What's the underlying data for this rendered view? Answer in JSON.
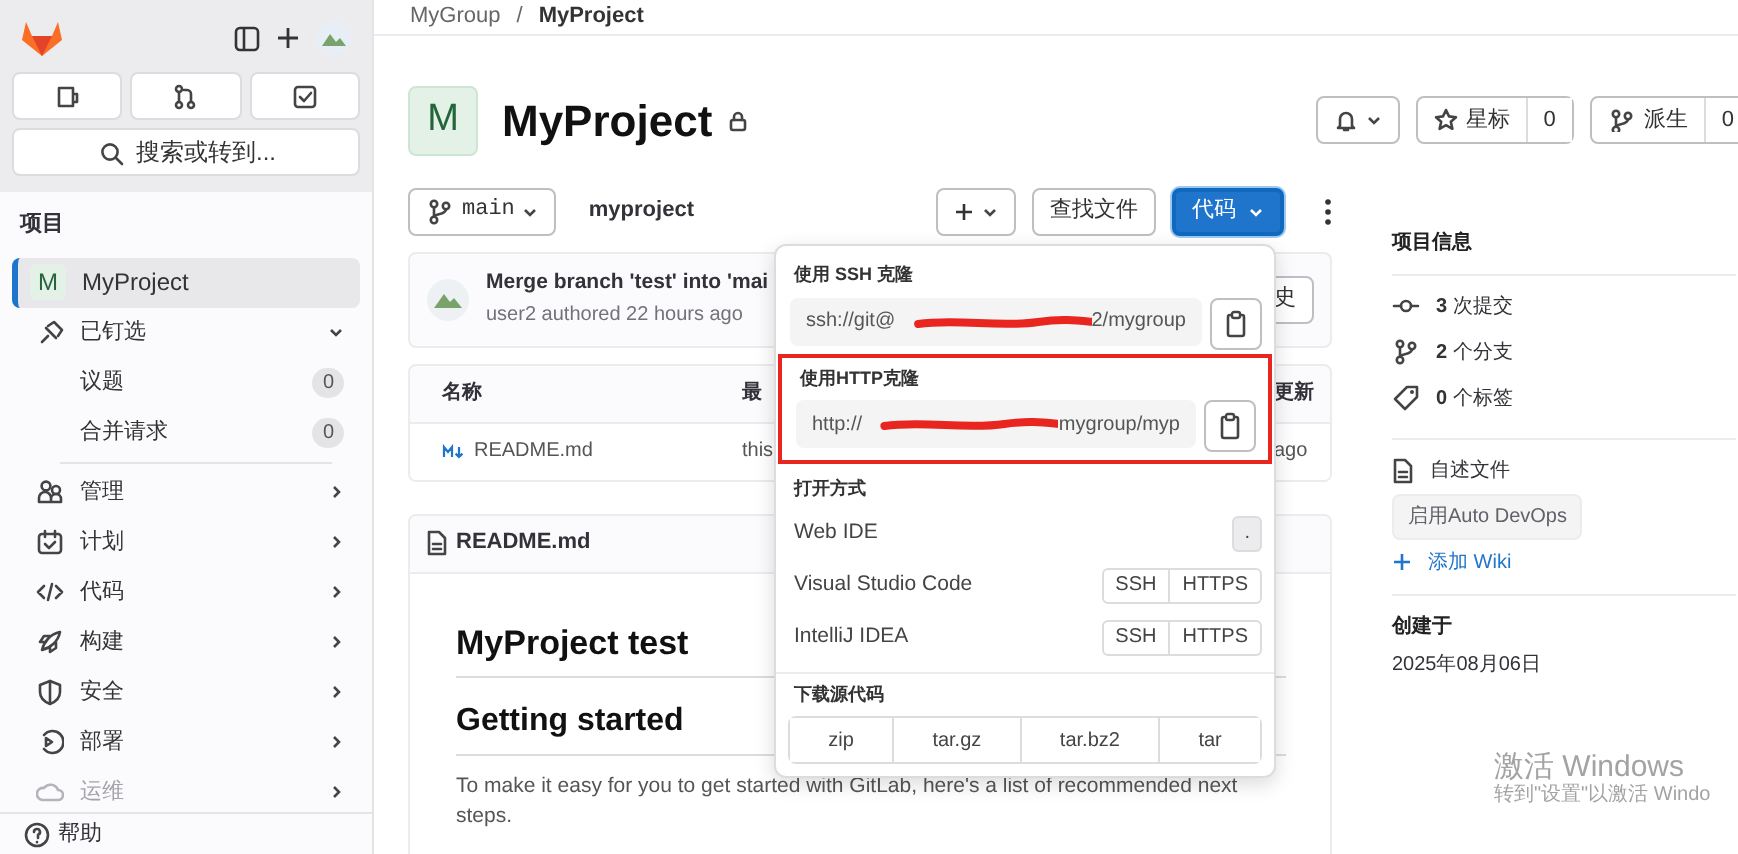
{
  "sidebar": {
    "search": {
      "placeholder": "搜索或转到..."
    },
    "section_title": "项目",
    "items": [
      {
        "kind": "project",
        "avatar": "M",
        "label": "MyProject",
        "selected": true
      },
      {
        "kind": "group",
        "label": "已钉选",
        "expanded": true,
        "selected": false
      },
      {
        "kind": "sub",
        "label": "议题",
        "count": "0",
        "selected": false
      },
      {
        "kind": "sub",
        "label": "合并请求",
        "count": "0",
        "selected": false
      },
      {
        "kind": "menu",
        "label": "管理",
        "selected": false
      },
      {
        "kind": "menu",
        "label": "计划",
        "selected": false
      },
      {
        "kind": "menu",
        "label": "代码",
        "selected": false
      },
      {
        "kind": "menu",
        "label": "构建",
        "selected": false
      },
      {
        "kind": "menu",
        "label": "安全",
        "selected": false
      },
      {
        "kind": "menu",
        "label": "部署",
        "selected": false
      },
      {
        "kind": "menu",
        "label": "运维",
        "selected": false,
        "faded": true
      }
    ],
    "help": "帮助"
  },
  "breadcrumb": [
    {
      "label": "MyGroup",
      "current": false
    },
    {
      "separator": "/",
      "label": "MyProject",
      "current": true
    }
  ],
  "project": {
    "avatar": "M",
    "name": "MyProject"
  },
  "star": {
    "label": "星标",
    "count": "0"
  },
  "fork": {
    "label": "派生",
    "count": "0"
  },
  "branch": "main",
  "path": "myproject",
  "find_file": "查找文件",
  "code_button": "代码",
  "commit": {
    "title": "Merge branch 'test' into 'mai",
    "meta": "user2 authored 22 hours ago",
    "history": "史"
  },
  "files": {
    "columns": [
      "名称",
      "最",
      "更新"
    ],
    "rows": [
      {
        "cells": [
          "README.md",
          "this",
          "ago"
        ]
      }
    ]
  },
  "readme": {
    "title": "README.md",
    "h1": "MyProject test",
    "h2": "Getting started",
    "paragraph": "To make it easy for you to get started with GitLab, here's a list of recommended next steps."
  },
  "clone_menu": {
    "sections": [
      {
        "title": "使用 SSH 克隆",
        "prefix": "ssh://git@",
        "suffix": "2/mygroup",
        "highlighted": false
      },
      {
        "title": "使用HTTP克隆",
        "prefix": "http://",
        "suffix": "mygroup/myp",
        "highlighted": true
      }
    ],
    "open_title": "打开方式",
    "open_with": [
      {
        "label": "Web IDE",
        "buttons": [
          "."
        ]
      },
      {
        "label": "Visual Studio Code",
        "buttons": [
          "SSH",
          "HTTPS"
        ]
      },
      {
        "label": "IntelliJ IDEA",
        "buttons": [
          "SSH",
          "HTTPS"
        ]
      }
    ],
    "download_title": "下载源代码",
    "downloads": [
      "zip",
      "tar.gz",
      "tar.bz2",
      "tar"
    ]
  },
  "project_info": {
    "title": "项目信息",
    "stats": [
      {
        "kind": "commit",
        "count": "3",
        "label": "次提交"
      },
      {
        "kind": "branch",
        "count": "2",
        "label": "个分支"
      },
      {
        "kind": "tag",
        "count": "0",
        "label": "个标签"
      }
    ],
    "readme": "自述文件",
    "autodevops": "启用Auto DevOps",
    "add_wiki": "添加 Wiki",
    "created_title": "创建于",
    "created": "2025年08月06日"
  },
  "os_notice": {
    "title": "激活 Windows",
    "text": "转到\"设置\"以激活 Windo"
  }
}
